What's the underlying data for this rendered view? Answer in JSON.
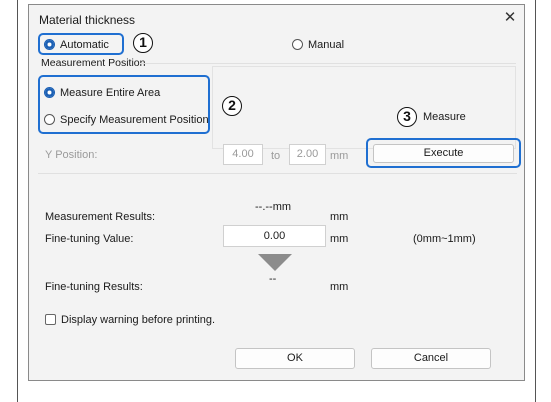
{
  "dialog": {
    "title": "Material thickness",
    "close_glyph": "✕"
  },
  "mode": {
    "automatic_label": "Automatic",
    "manual_label": "Manual",
    "selected": "Automatic"
  },
  "measurement_position": {
    "group_label": "Measurement Position",
    "entire_area_label": "Measure Entire Area",
    "specify_label": "Specify Measurement Position",
    "selected": "Measure Entire Area"
  },
  "measure": {
    "label": "Measure",
    "execute_label": "Execute"
  },
  "y_position": {
    "label": "Y Position:",
    "from_value": "4.00",
    "to_label": "to",
    "to_value": "2.00",
    "unit": "mm"
  },
  "results": {
    "measurement_label": "Measurement Results:",
    "measurement_value": "--.--mm",
    "measurement_unit": "mm",
    "finetuning_label": "Fine-tuning Value:",
    "finetuning_value": "0.00",
    "finetuning_unit": "mm",
    "finetuning_range": "(0mm~1mm)",
    "finetuning_results_label": "Fine-tuning Results:",
    "finetuning_results_value": "--",
    "finetuning_results_unit": "mm"
  },
  "warning": {
    "label": "Display warning before printing.",
    "checked": false
  },
  "buttons": {
    "ok_label": "OK",
    "cancel_label": "Cancel"
  },
  "callouts": {
    "one": "1",
    "two": "2",
    "three": "3"
  },
  "colors": {
    "highlight": "#1f6fd1",
    "radio_selected": "#1a5fb4"
  }
}
